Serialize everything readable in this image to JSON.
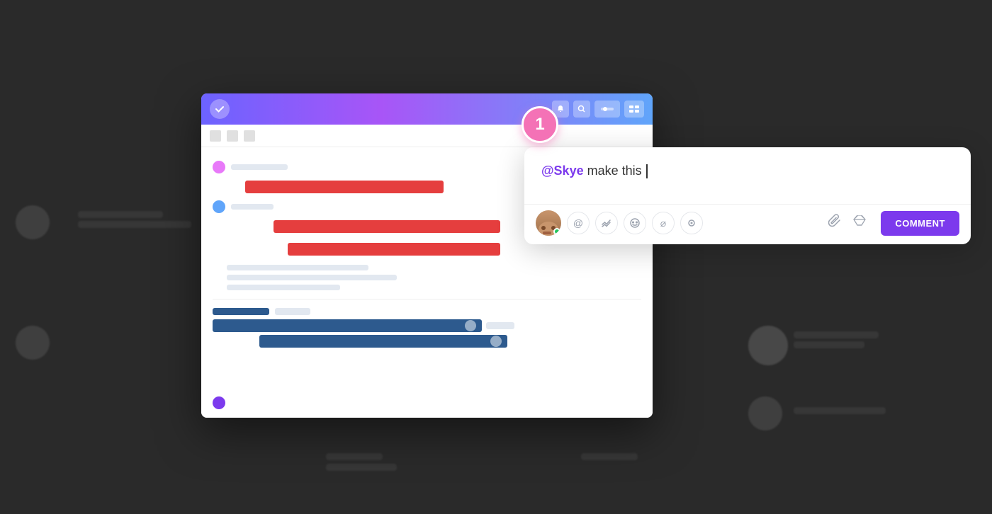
{
  "background": {
    "color": "#2d2d2d"
  },
  "notification_badge": {
    "number": "1"
  },
  "comment_popup": {
    "mention": "@Skye",
    "text": " make this ",
    "toolbar_icons": [
      "at-icon",
      "clickup-icon",
      "emoji-icon",
      "slash-icon",
      "circle-icon"
    ],
    "comment_button_label": "COMMENT",
    "attachment_icon": "paperclip-icon",
    "drive_icon": "drive-icon"
  },
  "inner_app": {
    "header_gradient": "linear-gradient(90deg, #6c63ff, #a855f7, #60a5fa)"
  }
}
